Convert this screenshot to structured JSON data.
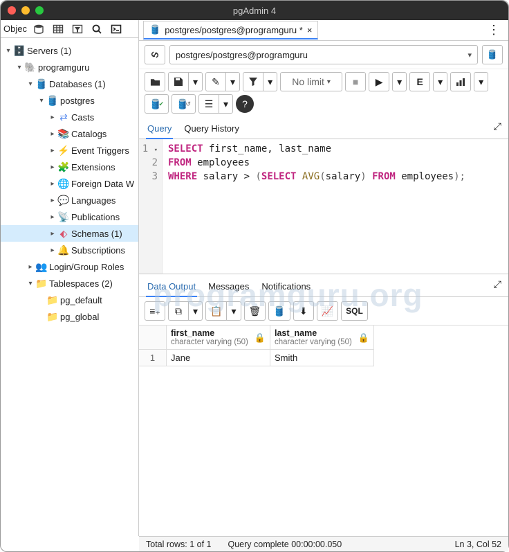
{
  "window": {
    "title": "pgAdmin 4"
  },
  "leftTop": {
    "label": "Objec"
  },
  "tree": {
    "servers": "Servers (1)",
    "server": "programguru",
    "databases": "Databases (1)",
    "db": "postgres",
    "casts": "Casts",
    "catalogs": "Catalogs",
    "eventTriggers": "Event Triggers",
    "extensions": "Extensions",
    "fdw": "Foreign Data W",
    "languages": "Languages",
    "publications": "Publications",
    "schemas": "Schemas (1)",
    "subscriptions": "Subscriptions",
    "loginRoles": "Login/Group Roles",
    "tablespaces": "Tablespaces (2)",
    "pgDefault": "pg_default",
    "pgGlobal": "pg_global"
  },
  "tab": {
    "title": "postgres/postgres@programguru *",
    "close": "×"
  },
  "conn": {
    "text": "postgres/postgres@programguru"
  },
  "limit": "No limit",
  "qtabs": {
    "query": "Query",
    "history": "Query History"
  },
  "sql": {
    "l1a": "SELECT",
    "l1b": " first_name",
    "l1c": ",",
    "l1d": " last_name",
    "l2a": "FROM",
    "l2b": " employees",
    "l3a": "WHERE",
    "l3b": " salary ",
    "l3c": ">",
    "l3d": " (",
    "l3e": "SELECT",
    "l3f": " ",
    "l3g": "AVG",
    "l3h": "(",
    "l3i": "salary",
    "l3j": ")",
    "l3k": " ",
    "l3l": "FROM",
    "l3m": " employees",
    "l3n": ");"
  },
  "gutter": {
    "n1": "1",
    "n2": "2",
    "n3": "3"
  },
  "otabs": {
    "data": "Data Output",
    "messages": "Messages",
    "notifications": "Notifications"
  },
  "sqlbtn": "SQL",
  "columns": {
    "c1name": "first_name",
    "c1type": "character varying (50)",
    "c2name": "last_name",
    "c2type": "character varying (50)"
  },
  "row": {
    "idx": "1",
    "c1": "Jane",
    "c2": "Smith"
  },
  "status": {
    "rows": "Total rows: 1 of 1",
    "time": "Query complete 00:00:00.050",
    "pos": "Ln 3, Col 52"
  },
  "watermark": "programguru.org"
}
